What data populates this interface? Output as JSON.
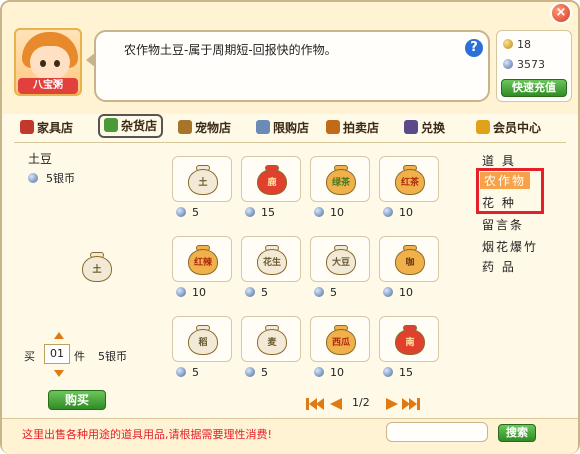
{
  "header": {
    "avatar_badge": "八宝粥",
    "description": "农作物土豆-属于周期短-回报快的作物。",
    "help_label": "?",
    "close_label": "×",
    "wallet": {
      "gold": "18",
      "silver": "3573",
      "recharge_label": "快速充值"
    }
  },
  "tabs": [
    {
      "label": "家具店",
      "icon": "house-icon"
    },
    {
      "label": "杂货店",
      "icon": "clover-icon"
    },
    {
      "label": "宠物店",
      "icon": "pet-icon"
    },
    {
      "label": "限购店",
      "icon": "bottle-icon"
    },
    {
      "label": "拍卖店",
      "icon": "hammer-icon"
    },
    {
      "label": "兑换",
      "icon": "castle-icon"
    },
    {
      "label": "会员中心",
      "icon": "crown-icon"
    }
  ],
  "active_tab": "杂货店",
  "detail": {
    "name": "土豆",
    "price": "5银币",
    "bag_label": "土",
    "quantity_label": "买",
    "quantity": "01",
    "quantity_unit": "件",
    "total": "5银币",
    "buy_label": "购买"
  },
  "items": [
    {
      "label": "土",
      "price": "5",
      "color": "#f2ead6",
      "text_color": "#6b5a2e"
    },
    {
      "label": "鹿",
      "price": "15",
      "color": "#e2402f",
      "text_color": "#ffe9a0"
    },
    {
      "label": "绿茶",
      "price": "10",
      "color": "#f0b14a",
      "text_color": "#4a7a20"
    },
    {
      "label": "红茶",
      "price": "10",
      "color": "#f0b14a",
      "text_color": "#b02a10"
    },
    {
      "label": "红辣",
      "price": "10",
      "color": "#f0b14a",
      "text_color": "#b02a10"
    },
    {
      "label": "花生",
      "price": "5",
      "color": "#f2ead6",
      "text_color": "#6b5a2e"
    },
    {
      "label": "大豆",
      "price": "5",
      "color": "#f2ead6",
      "text_color": "#6b5a2e"
    },
    {
      "label": "咖",
      "price": "10",
      "color": "#f0b14a",
      "text_color": "#6b3a10"
    },
    {
      "label": "稻",
      "price": "5",
      "color": "#f2ead6",
      "text_color": "#6b5a2e"
    },
    {
      "label": "麦",
      "price": "5",
      "color": "#f2ead6",
      "text_color": "#6b5a2e"
    },
    {
      "label": "西瓜",
      "price": "10",
      "color": "#f0b14a",
      "text_color": "#b02a10"
    },
    {
      "label": "南",
      "price": "15",
      "color": "#e2402f",
      "text_color": "#ffe9a0"
    }
  ],
  "categories": [
    "道 具",
    "农作物",
    "花 种",
    "留言条",
    "烟花爆竹",
    "药 品"
  ],
  "selected_category": "农作物",
  "pager": {
    "text": "1/2"
  },
  "footer": {
    "notice": "这里出售各种用途的道具用品,请根据需要理性消费!",
    "search_label": "搜索"
  }
}
